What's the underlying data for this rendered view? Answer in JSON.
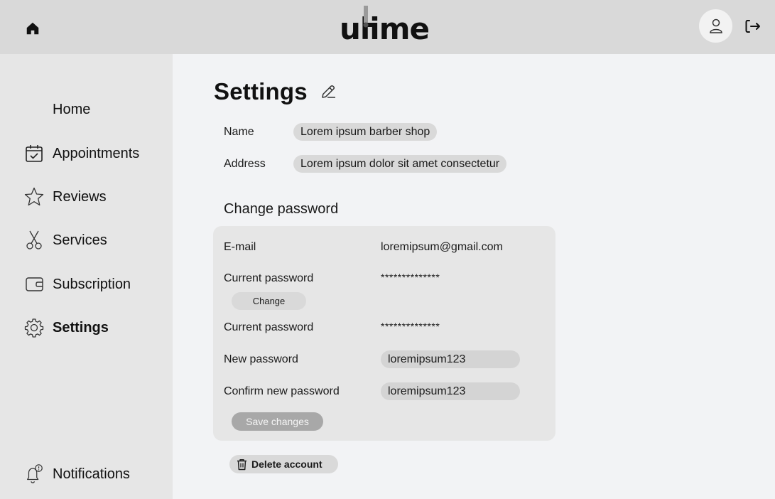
{
  "header": {
    "logo": "ulime",
    "home_icon": "home-icon",
    "avatar_icon": "user-icon",
    "logout_icon": "logout-icon"
  },
  "sidebar": {
    "items": [
      {
        "label": "Home",
        "icon": "none",
        "active": false
      },
      {
        "label": "Appointments",
        "icon": "calendar-check-icon",
        "active": false
      },
      {
        "label": "Reviews",
        "icon": "star-icon",
        "active": false
      },
      {
        "label": "Services",
        "icon": "scissors-icon",
        "active": false
      },
      {
        "label": "Subscription",
        "icon": "wallet-icon",
        "active": false
      },
      {
        "label": "Settings",
        "icon": "gear-icon",
        "active": true
      },
      {
        "label": "Notifications",
        "icon": "bell-icon",
        "active": false
      }
    ]
  },
  "main": {
    "title": "Settings",
    "name_label": "Name",
    "name_value": "Lorem ipsum barber shop",
    "address_label": "Address",
    "address_value": "Lorem ipsum dolor sit amet consectetur",
    "change_password_title": "Change password",
    "card": {
      "email_label": "E-mail",
      "email_value": "loremipsum@gmail.com",
      "current_password_label": "Current password",
      "current_password_value": "**************",
      "change_button": "Change",
      "current_password_label_2": "Current password",
      "current_password_value_2": "**************",
      "new_password_label": "New password",
      "new_password_value": "loremipsum123",
      "confirm_password_label": "Confirm new password",
      "confirm_password_value": "loremipsum123",
      "save_button": "Save changes"
    },
    "delete_button": "Delete account"
  },
  "colors": {
    "topbar": "#d9d9d9",
    "sidebar": "#e6e6e6",
    "main_bg": "#f2f3f5",
    "pill": "#d9d9d9",
    "save_button": "#a8a8a8"
  }
}
